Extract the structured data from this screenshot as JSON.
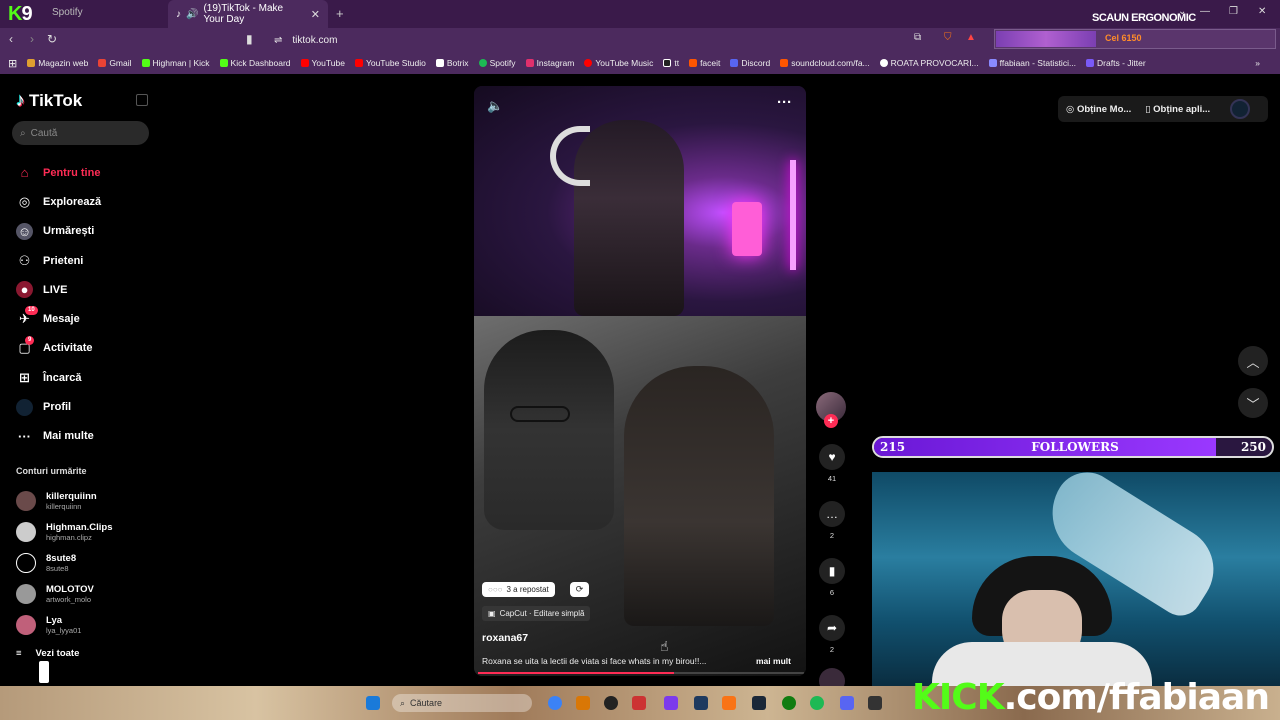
{
  "browser": {
    "tabs": [
      {
        "label": "Spotify",
        "active": false
      },
      {
        "label": "(19)TikTok - Make Your Day",
        "active": true
      }
    ],
    "url": "tiktok.com",
    "promo_text": "SCAUN ERGONOMIC",
    "extension_label": "Cel 6150",
    "bookmarks": [
      {
        "label": "Magazin web",
        "color": "#e0a030"
      },
      {
        "label": "Gmail",
        "color": "#ea4335"
      },
      {
        "label": "Highman | Kick",
        "color": "#53fc18"
      },
      {
        "label": "Kick Dashboard",
        "color": "#53fc18"
      },
      {
        "label": "YouTube",
        "color": "#ff0000"
      },
      {
        "label": "YouTube Studio",
        "color": "#ff0000"
      },
      {
        "label": "Botrix",
        "color": "#ffffff"
      },
      {
        "label": "Spotify",
        "color": "#1db954"
      },
      {
        "label": "Instagram",
        "color": "#e1306c"
      },
      {
        "label": "YouTube Music",
        "color": "#ff0000"
      },
      {
        "label": "tt",
        "color": "#ffffff"
      },
      {
        "label": "faceit",
        "color": "#ff5500"
      },
      {
        "label": "Discord",
        "color": "#5865f2"
      },
      {
        "label": "soundcloud.com/fa...",
        "color": "#ff5500"
      },
      {
        "label": "ROATA PROVOCARI...",
        "color": "#ffffff"
      },
      {
        "label": "ffabiaan - Statistici...",
        "color": "#8a8aff"
      },
      {
        "label": "Drafts - Jitter",
        "color": "#7a5af8"
      }
    ]
  },
  "tiktok": {
    "logo": "TikTok",
    "search_placeholder": "Caută",
    "nav": [
      {
        "label": "Pentru tine",
        "icon": "home-icon",
        "active": true
      },
      {
        "label": "Explorează",
        "icon": "compass-icon"
      },
      {
        "label": "Urmărești",
        "icon": "following-icon"
      },
      {
        "label": "Prieteni",
        "icon": "friends-icon"
      },
      {
        "label": "LIVE",
        "icon": "live-icon"
      },
      {
        "label": "Mesaje",
        "icon": "messages-icon",
        "badge": "10"
      },
      {
        "label": "Activitate",
        "icon": "activity-icon",
        "badge": "9"
      },
      {
        "label": "Încarcă",
        "icon": "upload-icon"
      },
      {
        "label": "Profil",
        "icon": "profile-icon"
      },
      {
        "label": "Mai multe",
        "icon": "more-icon"
      }
    ],
    "following_title": "Conturi urmărite",
    "following": [
      {
        "name": "killerquiinn",
        "handle": "killerquiinn"
      },
      {
        "name": "Highman.Clips",
        "handle": "highman.clipz"
      },
      {
        "name": "8sute8",
        "handle": "8sute8"
      },
      {
        "name": "MOLOTOV",
        "handle": "artwork_molo"
      },
      {
        "name": "Lya",
        "handle": "lya_lyya01"
      }
    ],
    "see_all": "Vezi toate",
    "video": {
      "reposts": "3 a repostat",
      "capcut": "CapCut · Editare simplă",
      "author": "roxana67",
      "description": "Roxana se uita la lectii de viata si face whats in my birou!!...",
      "more": "mai mult",
      "likes": "41",
      "comments": "2",
      "saves": "6",
      "shares": "2"
    },
    "top_right": {
      "get_coins": "Obține Mo...",
      "get_app": "Obține apli..."
    }
  },
  "overlay": {
    "followers_current": "215",
    "followers_label": "FOLLOWERS",
    "followers_goal": "250",
    "followers_progress": 0.86,
    "kick_prefix": "KICK",
    "kick_suffix": ".com/ffabiaan"
  },
  "taskbar": {
    "search_placeholder": "Căutare"
  }
}
